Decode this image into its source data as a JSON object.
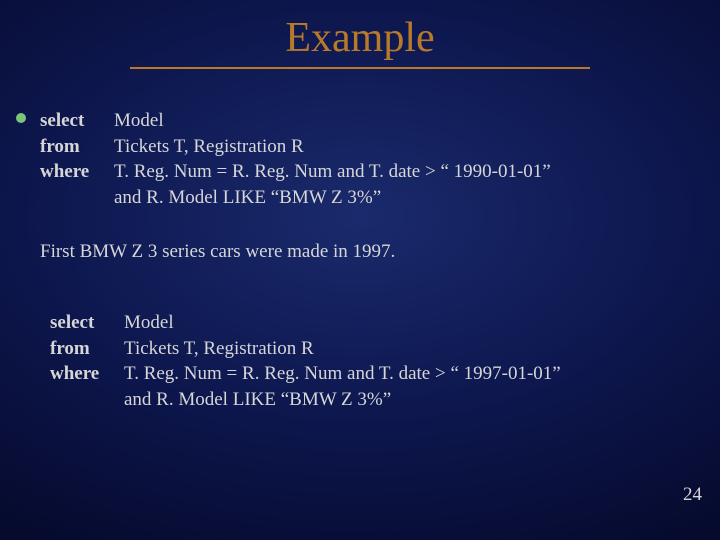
{
  "title": "Example",
  "pagenum": "24",
  "block1": {
    "select_kw": "select",
    "select_val": "Model",
    "from_kw": "from",
    "from_val": "Tickets T, Registration R",
    "where_kw": "where",
    "where_val": "T. Reg. Num = R. Reg. Num and T. date > “ 1990-01-01”",
    "where_cont": "and R. Model LIKE  “BMW Z 3%”"
  },
  "commentary": "First BMW Z 3 series cars were made in 1997.",
  "block2": {
    "select_kw": "select",
    "select_val": "Model",
    "from_kw": "from",
    "from_val": "Tickets T, Registration R",
    "where_kw": "where",
    "where_val": "T. Reg. Num = R. Reg. Num and T. date > “ 1997-01-01”",
    "where_cont": "and R. Model LIKE  “BMW Z 3%”"
  }
}
